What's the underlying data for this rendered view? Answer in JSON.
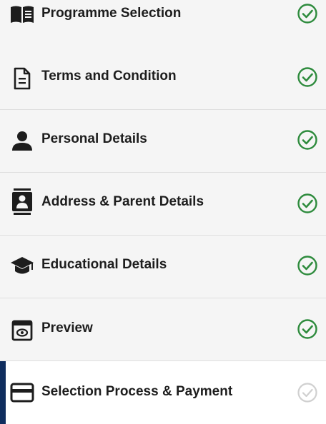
{
  "steps": [
    {
      "label": "Programme Selection",
      "icon": "book-open-icon",
      "status": "completed"
    },
    {
      "label": "Terms and Condition",
      "icon": "document-icon",
      "status": "completed"
    },
    {
      "label": "Personal Details",
      "icon": "user-icon",
      "status": "completed"
    },
    {
      "label": "Address & Parent Details",
      "icon": "contact-card-icon",
      "status": "completed"
    },
    {
      "label": "Educational Details",
      "icon": "graduation-cap-icon",
      "status": "completed"
    },
    {
      "label": "Preview",
      "icon": "preview-icon",
      "status": "completed"
    },
    {
      "label": "Selection Process & Payment",
      "icon": "credit-card-icon",
      "status": "pending"
    }
  ],
  "active_step": "Selection Process & Payment",
  "colors": {
    "completed_check": "#2e8b3d",
    "pending_check": "#d0d0d0",
    "active_marker": "#0f2d5e",
    "text": "#1d1d1d"
  }
}
